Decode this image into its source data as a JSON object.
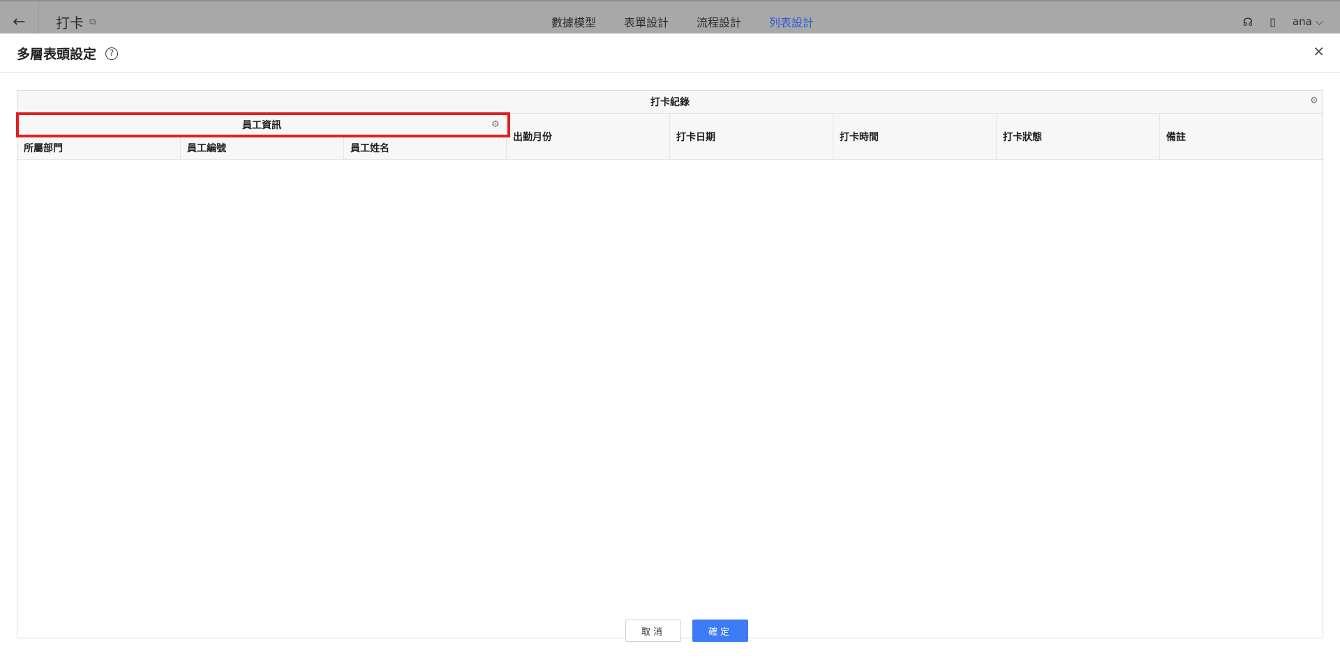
{
  "topbar": {
    "back_icon": "arrow-left-icon",
    "app_title": "打卡",
    "external_icon": "external-link-icon",
    "nav": [
      {
        "label": "數據模型",
        "active": false
      },
      {
        "label": "表單設計",
        "active": false
      },
      {
        "label": "流程設計",
        "active": false
      },
      {
        "label": "列表設計",
        "active": true
      }
    ],
    "user": "ana",
    "accent_color": "#2a5bd6"
  },
  "modal": {
    "title": "多層表頭設定",
    "help_icon": "question-circle-icon",
    "close_icon": "close-icon"
  },
  "table": {
    "group_header": "打卡紀錄",
    "subgroup_header": "員工資訊",
    "subgroup_columns": [
      "所屬部門",
      "員工編號",
      "員工姓名"
    ],
    "columns": [
      "出勤月份",
      "打卡日期",
      "打卡時間",
      "打卡狀態",
      "備註"
    ],
    "highlight_color": "#e02020"
  },
  "footer": {
    "cancel_label": "取消",
    "ok_label": "確定",
    "primary_color": "#3d7cf5"
  }
}
